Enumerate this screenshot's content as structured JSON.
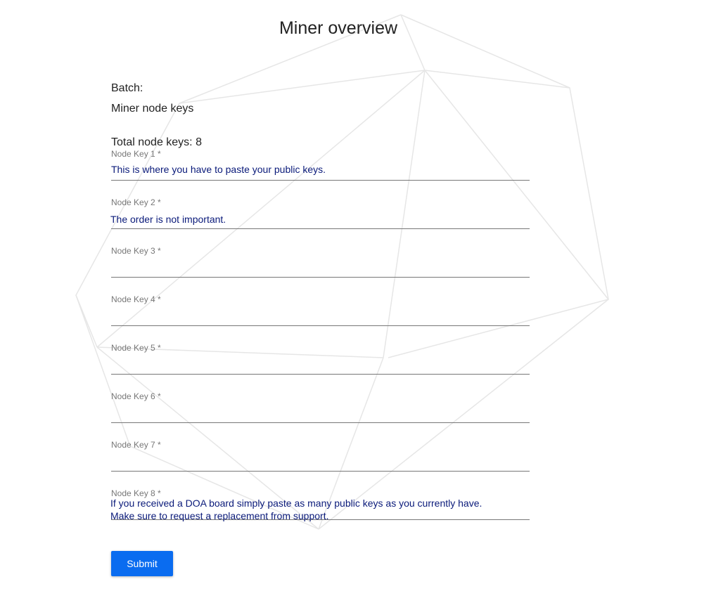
{
  "page": {
    "title": "Miner overview"
  },
  "batch": {
    "label": "Batch:",
    "value": "Miner node keys"
  },
  "summary": {
    "total_label": "Total node keys: 8"
  },
  "fields": [
    {
      "label": "Node Key 1 *",
      "value": ""
    },
    {
      "label": "Node Key 2 *",
      "value": ""
    },
    {
      "label": "Node Key 3 *",
      "value": ""
    },
    {
      "label": "Node Key 4 *",
      "value": ""
    },
    {
      "label": "Node Key 5 *",
      "value": ""
    },
    {
      "label": "Node Key 6 *",
      "value": ""
    },
    {
      "label": "Node Key 7 *",
      "value": ""
    },
    {
      "label": "Node Key 8 *",
      "value": ""
    }
  ],
  "annotations": {
    "a1": "This is where you have to paste your public keys.",
    "a2": "The order is not important.",
    "a3_line1": "If you received a DOA board simply paste as many public keys as you currently have.",
    "a3_line2": "Make sure to request a replacement from support."
  },
  "actions": {
    "submit_label": "Submit"
  },
  "colors": {
    "primary": "#0a6cf0",
    "annotation_text": "#0a1a7a",
    "label_grey": "#777777",
    "background_lines": "#e6e6e6"
  }
}
